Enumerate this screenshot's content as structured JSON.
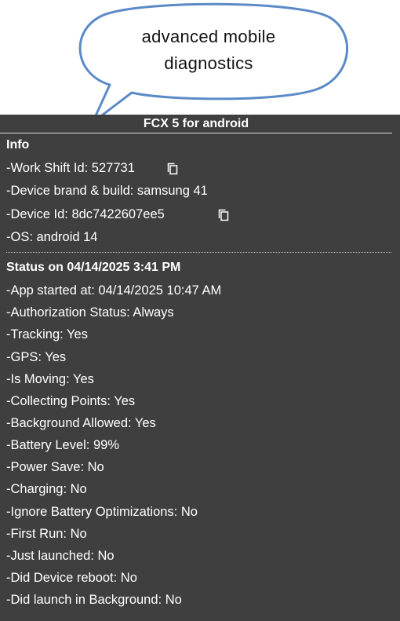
{
  "callout": {
    "line1": "advanced mobile",
    "line2": "diagnostics"
  },
  "panel": {
    "title": "FCX 5 for android"
  },
  "info": {
    "title": "Info",
    "work_shift": "-Work Shift Id: 527731",
    "device_brand": "-Device brand & build: samsung 41",
    "device_id": "-Device Id: 8dc7422607ee5",
    "os": "-OS: android 14",
    "copy_icon": "copy-icon"
  },
  "status": {
    "title": "Status on 04/14/2025 3:41 PM",
    "items": [
      "-App started at: 04/14/2025 10:47 AM",
      "-Authorization Status: Always",
      "-Tracking: Yes",
      "-GPS: Yes",
      "-Is Moving: Yes",
      "-Collecting Points: Yes",
      "-Background Allowed: Yes",
      "-Battery Level: 99%",
      "-Power Save: No",
      "-Charging: No",
      "-Ignore Battery Optimizations: No",
      "-First Run: No",
      "-Just launched: No",
      "-Did Device reboot: No",
      "-Did launch in Background: No"
    ]
  },
  "colors": {
    "panel_bg": "#3f3f3f",
    "callout_border": "#5b8ac7",
    "text": "#ffffff"
  }
}
